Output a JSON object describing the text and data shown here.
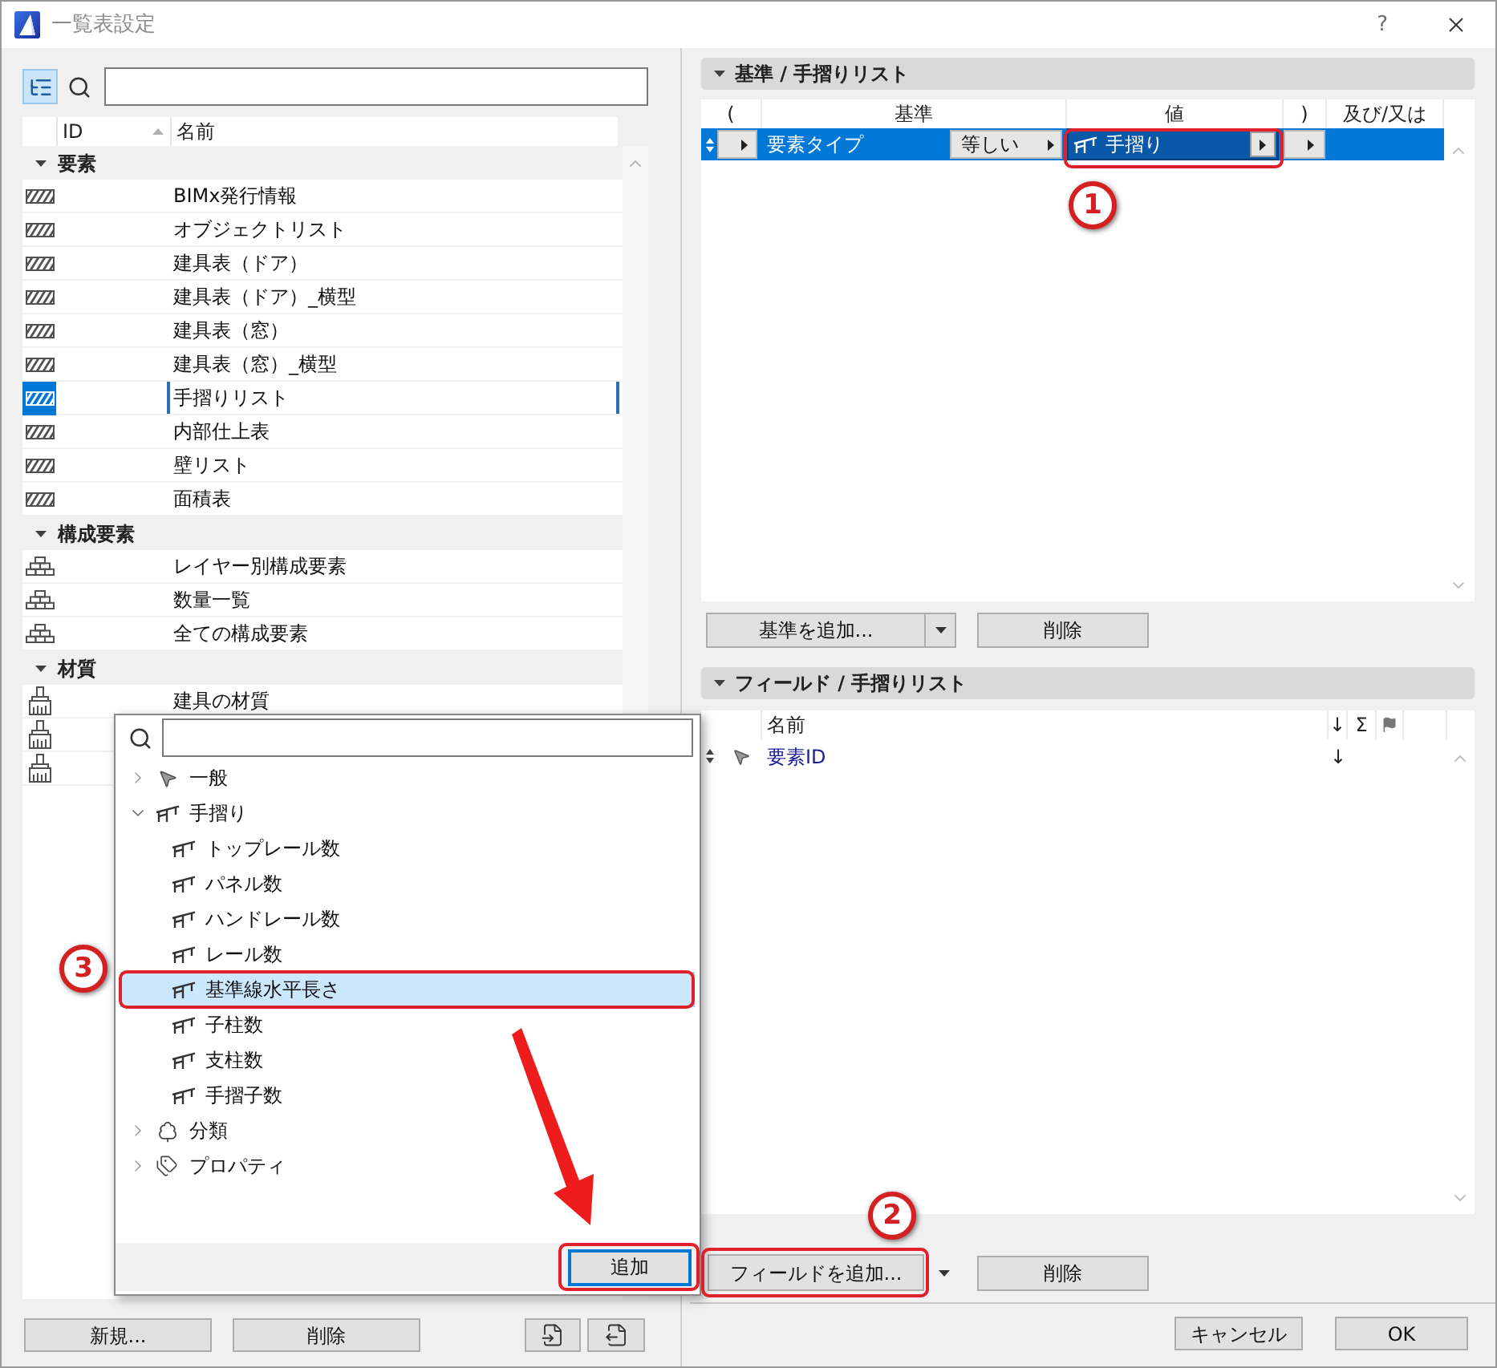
{
  "window": {
    "title": "一覧表設定",
    "help": "?"
  },
  "schedules": {
    "view_toggle": {
      "selected": true
    },
    "columns": [
      {
        "label": "ID",
        "sorted": true
      },
      {
        "label": "名前",
        "sorted": false
      }
    ],
    "groups": [
      {
        "label": "要素",
        "kind": "element",
        "expanded": true,
        "items": [
          {
            "name": "BIMx発行情報",
            "selected": false
          },
          {
            "name": "オブジェクトリスト",
            "selected": false
          },
          {
            "name": "建具表（ドア）",
            "selected": false
          },
          {
            "name": "建具表（ドア）_横型",
            "selected": false
          },
          {
            "name": "建具表（窓）",
            "selected": false
          },
          {
            "name": "建具表（窓）_横型",
            "selected": false
          },
          {
            "name": "手摺りリスト",
            "selected": true
          },
          {
            "name": "内部仕上表",
            "selected": false
          },
          {
            "name": "壁リスト",
            "selected": false
          },
          {
            "name": "面積表",
            "selected": false
          }
        ]
      },
      {
        "label": "構成要素",
        "kind": "component",
        "expanded": true,
        "items": [
          {
            "name": "レイヤー別構成要素",
            "selected": false
          },
          {
            "name": "数量一覧",
            "selected": false
          },
          {
            "name": "全ての構成要素",
            "selected": false
          }
        ]
      },
      {
        "label": "材質",
        "kind": "material",
        "expanded": true,
        "items": [
          {
            "name": "建具の材質",
            "selected": false
          },
          {
            "selected": false
          },
          {
            "selected": false
          }
        ]
      }
    ],
    "buttons": [
      "新規...",
      "削除"
    ]
  },
  "criteria": {
    "title": "基準 / 手摺りリスト",
    "expanded": true,
    "columns": [
      "(",
      "基準",
      "値",
      ")",
      "及び/又は"
    ],
    "rows": [
      {
        "criterion": "要素タイプ",
        "operator": "等しい",
        "value": "手摺り",
        "selected": true,
        "value_highlighted": true,
        "marker": "1"
      }
    ],
    "add_button": "基準を追加...",
    "delete_button": "削除"
  },
  "fields": {
    "title": "フィールド / 手摺りリスト",
    "expanded": true,
    "columns": [
      "名前",
      "↓",
      "Σ"
    ],
    "rows": [
      {
        "name": "要素ID",
        "sort": "↓",
        "selected": false
      }
    ],
    "add_button": {
      "label": "フィールドを追加...",
      "highlighted": true,
      "marker": "2"
    },
    "delete_button": "削除"
  },
  "footer": {
    "buttons": [
      "キャンセル",
      "OK"
    ]
  },
  "popup": {
    "tree": [
      {
        "label": "一般",
        "kind": "general",
        "expanded": false,
        "selected": false
      },
      {
        "label": "手摺り",
        "kind": "railing",
        "expanded": true,
        "selected": false,
        "children": [
          {
            "label": "トップレール数",
            "kind": "railing",
            "selected": false,
            "highlighted": false
          },
          {
            "label": "パネル数",
            "kind": "railing",
            "selected": false,
            "highlighted": false
          },
          {
            "label": "ハンドレール数",
            "kind": "railing",
            "selected": false,
            "highlighted": false
          },
          {
            "label": "レール数",
            "kind": "railing",
            "selected": false,
            "highlighted": false
          },
          {
            "label": "基準線水平長さ",
            "kind": "railing",
            "selected": true,
            "highlighted": true,
            "marker": "3"
          },
          {
            "label": "子柱数",
            "kind": "railing",
            "selected": false,
            "highlighted": false
          },
          {
            "label": "支柱数",
            "kind": "railing",
            "selected": false,
            "highlighted": false
          },
          {
            "label": "手摺子数",
            "kind": "railing",
            "selected": false,
            "highlighted": false
          }
        ]
      },
      {
        "label": "分類",
        "kind": "classification",
        "expanded": false,
        "selected": false
      },
      {
        "label": "プロパティ",
        "kind": "property",
        "expanded": false,
        "selected": false
      }
    ],
    "add_button": {
      "label": "追加",
      "highlighted": true
    }
  }
}
